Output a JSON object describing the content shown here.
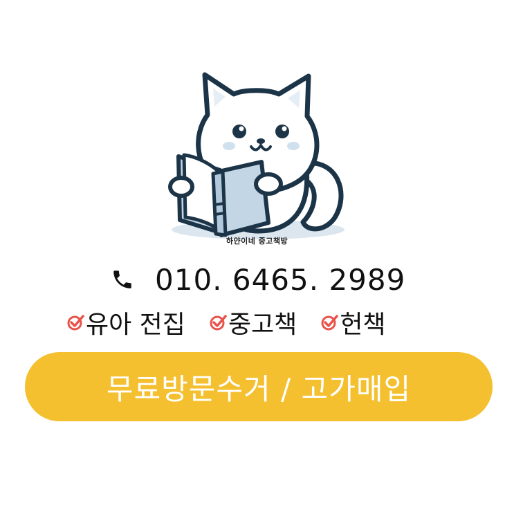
{
  "logo": {
    "shop_name": "하얀이네 중고책방",
    "mascot_icon": "cat-reading-book-icon"
  },
  "contact": {
    "phone_icon": "phone-icon",
    "phone_number": "010. 6465. 2989"
  },
  "tags": [
    {
      "label": "유아 전집",
      "icon": "check-circle-icon"
    },
    {
      "label": "중고책",
      "icon": "check-circle-icon"
    },
    {
      "label": "헌책",
      "icon": "check-circle-icon"
    }
  ],
  "cta": {
    "label": "무료방문수거 / 고가매입"
  },
  "colors": {
    "accent": "#f4c030",
    "check": "#e8534a",
    "text": "#111111",
    "cta_text": "#ffffff"
  }
}
